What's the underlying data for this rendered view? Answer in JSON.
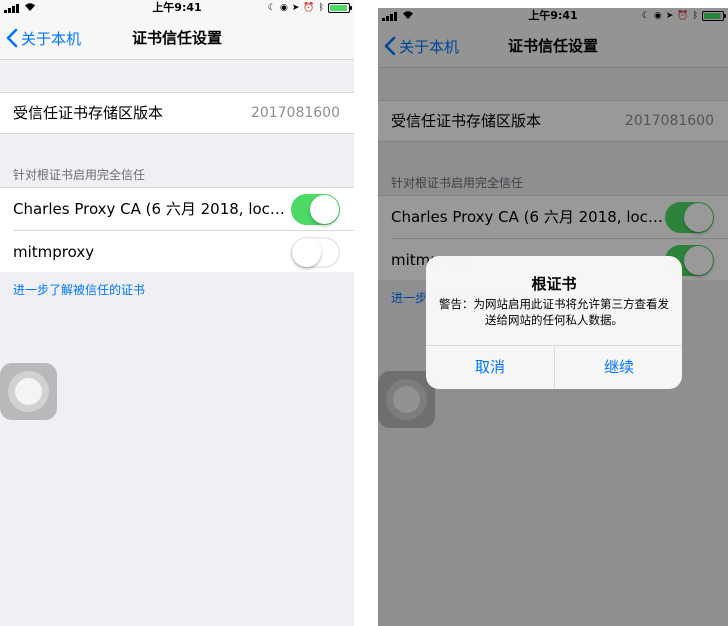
{
  "status_bar": {
    "time": "上午9:41",
    "battery_level": 0.85
  },
  "nav": {
    "back_label": "关于本机",
    "title": "证书信任设置"
  },
  "trust_store": {
    "label": "受信任证书存储区版本",
    "value": "2017081600"
  },
  "section": {
    "header": "针对根证书启用完全信任",
    "footer_link": "进一步了解被信任的证书"
  },
  "certificates": [
    {
      "name": "Charles Proxy CA (6 六月 2018, local...",
      "trusted": true
    },
    {
      "name": "mitmproxy",
      "trusted": false
    }
  ],
  "certificates_right": [
    {
      "name": "Charles Proxy CA (6 六月 2018, local...",
      "trusted": true
    },
    {
      "name": "mitmproxy",
      "trusted": true
    }
  ],
  "alert": {
    "title": "根证书",
    "message": "警告：为网站启用此证书将允许第三方查看发送给网站的任何私人数据。",
    "cancel_label": "取消",
    "continue_label": "继续"
  },
  "colors": {
    "accent": "#0076ff",
    "toggle_on": "#4cd964",
    "background": "#efeff4",
    "battery": "#4cd964"
  }
}
